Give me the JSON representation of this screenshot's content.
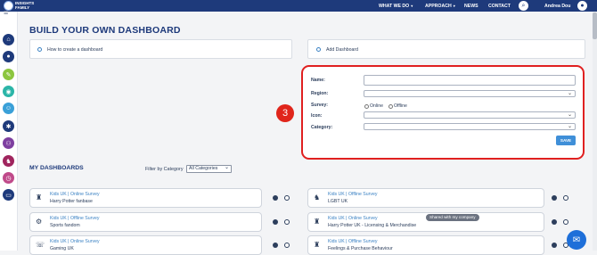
{
  "topbar": {
    "logo_text": "INSIGHTS FAMILY",
    "nav": [
      {
        "label": "WHAT WE DO",
        "has_caret": true
      },
      {
        "label": "APPROACH",
        "has_caret": true
      },
      {
        "label": "NEWS",
        "has_caret": false
      },
      {
        "label": "CONTACT",
        "has_caret": false
      }
    ],
    "user_name": "Andrea Dou"
  },
  "sidebar": {
    "icons": [
      {
        "name": "home-icon",
        "color": "#1e3a7b",
        "glyph": "⌂"
      },
      {
        "name": "lightbulb-icon",
        "color": "#1e3a7b",
        "glyph": "●"
      },
      {
        "name": "idea-green-icon",
        "color": "#8cc63f",
        "glyph": "✎"
      },
      {
        "name": "globe-icon",
        "color": "#2bb5a8",
        "glyph": "◉"
      },
      {
        "name": "people-icon",
        "color": "#3aa0d8",
        "glyph": "☺"
      },
      {
        "name": "network-icon",
        "color": "#1e3a7b",
        "glyph": "✱"
      },
      {
        "name": "connections-icon",
        "color": "#7e3fa0",
        "glyph": "⚇"
      },
      {
        "name": "brand-icon",
        "color": "#a0255e",
        "glyph": "♞"
      },
      {
        "name": "timer-icon",
        "color": "#c04a8a",
        "glyph": "◷"
      },
      {
        "name": "chat-icon",
        "color": "#1e3a7b",
        "glyph": "▭"
      }
    ]
  },
  "page": {
    "title": "BUILD YOUR OWN DASHBOARD"
  },
  "cards": {
    "how_to": "How to create a dashboard",
    "add_dashboard": "Add Dashboard"
  },
  "form": {
    "name_label": "Name:",
    "region_label": "Region:",
    "survey_label": "Survey:",
    "survey_option_online": "Online",
    "survey_option_offline": "Offline",
    "icon_label": "Icon:",
    "category_label": "Category:",
    "save_label": "SAVE"
  },
  "step_badge": "3",
  "my_dashboards": {
    "heading": "MY DASHBOARDS",
    "filter_label": "Filter by Category",
    "filter_value": "All Categories",
    "left": [
      {
        "line1": "Kids UK | Online Survey",
        "line2": "Harry Potter fanbase",
        "icon": "♜"
      },
      {
        "line1": "Kids UK | Offline Survey",
        "line2": "Sports fandom",
        "icon": "⚙"
      },
      {
        "line1": "Kids UK | Online Survey",
        "line2": "Gaming UK",
        "icon": "☏"
      }
    ],
    "right": [
      {
        "line1": "Kids UK | Offline Survey",
        "line2": "LGBT UK",
        "icon": "♞"
      },
      {
        "line1": "Kids UK | Online Survey",
        "line2": "Harry Potter UK - Licensing & Merchandise",
        "icon": "♜"
      },
      {
        "line1": "Kids UK | Offline Survey",
        "line2": "Feelings & Purchase Behaviour",
        "icon": "♜"
      }
    ],
    "share_badge": "Shared with my company"
  },
  "colors": {
    "brand": "#1e3a7b",
    "accent": "#3f8fd8",
    "highlight": "#e02020"
  }
}
